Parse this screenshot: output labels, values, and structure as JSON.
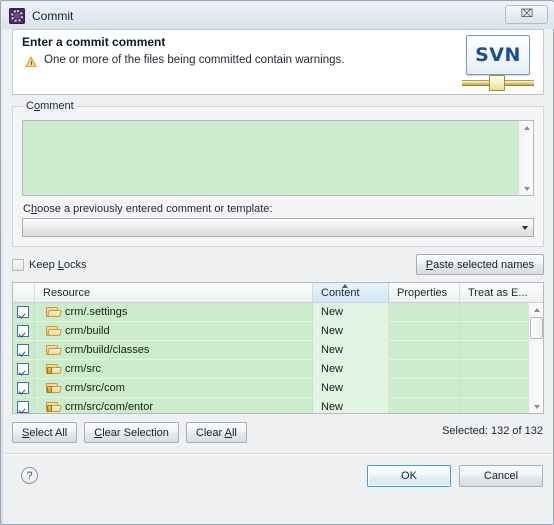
{
  "window": {
    "title": "Commit",
    "icon": "svn-commit-icon",
    "close_label": "⌧",
    "close_icon": "close-icon"
  },
  "header": {
    "title": "Enter a commit comment",
    "message": "One or more of the files being committed contain warnings.",
    "warning_icon": "warning-triangle-icon",
    "logo_text": "SVN",
    "logo_icon": "svn-logo-icon"
  },
  "comment_group": {
    "label_pre": "C",
    "label_mnemonic": "o",
    "label_post": "mment",
    "label_full": "Comment",
    "textarea_value": "",
    "textarea_placeholder": "",
    "choose_label_pre": "C",
    "choose_label_mnemonic": "h",
    "choose_label_post": "oose a previously entered comment or template:",
    "choose_label_full": "Choose a previously entered comment or template:",
    "combo_value": "",
    "combo_options": []
  },
  "locks": {
    "checkbox_label_pre": "Keep ",
    "checkbox_label_mnemonic": "L",
    "checkbox_label_post": "ocks",
    "checkbox_label_full": "Keep Locks",
    "checked": false,
    "paste_pre": "",
    "paste_mnemonic": "P",
    "paste_post": "aste selected names",
    "paste_full": "Paste selected names"
  },
  "table": {
    "columns": [
      {
        "key": "cb",
        "label": ""
      },
      {
        "key": "resource",
        "label": "Resource"
      },
      {
        "key": "content",
        "label": "Content",
        "sorted": true,
        "sort_dir": "asc"
      },
      {
        "key": "properties",
        "label": "Properties"
      },
      {
        "key": "treat",
        "label": "Treat as E..."
      }
    ],
    "rows": [
      {
        "checked": true,
        "icon": "folder-icon",
        "resource": "crm/.settings",
        "content": "New",
        "properties": "",
        "treat": ""
      },
      {
        "checked": true,
        "icon": "folder-icon",
        "resource": "crm/build",
        "content": "New",
        "properties": "",
        "treat": ""
      },
      {
        "checked": true,
        "icon": "folder-icon",
        "resource": "crm/build/classes",
        "content": "New",
        "properties": "",
        "treat": ""
      },
      {
        "checked": true,
        "icon": "source-folder-icon",
        "resource": "crm/src",
        "content": "New",
        "properties": "",
        "treat": ""
      },
      {
        "checked": true,
        "icon": "source-folder-icon",
        "resource": "crm/src/com",
        "content": "New",
        "properties": "",
        "treat": ""
      },
      {
        "checked": true,
        "icon": "source-folder-icon",
        "resource": "crm/src/com/entor",
        "content": "New",
        "properties": "",
        "treat": ""
      }
    ],
    "scrollbar": "vertical-scrollbar"
  },
  "selection_bar": {
    "select_all_pre": "",
    "select_all_mnemonic": "S",
    "select_all_post": "elect All",
    "select_all_full": "Select All",
    "clear_selection_pre": "",
    "clear_selection_mnemonic": "C",
    "clear_selection_post": "lear Selection",
    "clear_selection_full": "Clear Selection",
    "clear_all_pre": "Clear ",
    "clear_all_mnemonic": "A",
    "clear_all_post": "ll",
    "clear_all_full": "Clear All",
    "selected_count_text": "Selected: 132 of 132"
  },
  "footer": {
    "help_label": "?",
    "help_icon": "help-icon",
    "ok_label": "OK",
    "cancel_label": "Cancel",
    "default_button": "OK"
  },
  "colors": {
    "row_green": "#cdeccd",
    "content_col_green": "#e2f5e2",
    "sorted_header_blue": "#dcedf8",
    "svn_blue": "#1b4f8f",
    "warning_orange": "#e8a33d",
    "default_button_border": "#3c9fd6"
  }
}
